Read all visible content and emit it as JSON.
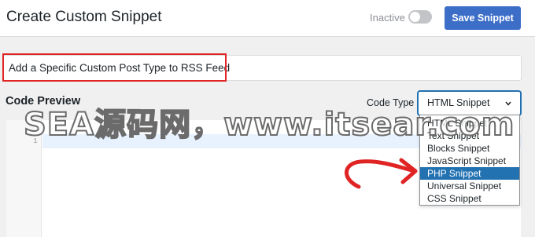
{
  "header": {
    "title": "Create Custom Snippet",
    "status_label": "Inactive",
    "toggle_state": "off",
    "save_label": "Save Snippet"
  },
  "snippet": {
    "title_value": "Add a Specific Custom Post Type to RSS Feed"
  },
  "code_section": {
    "preview_label": "Code Preview",
    "code_type_label": "Code Type",
    "selected_type": "HTML Snippet",
    "line_numbers": [
      "1"
    ]
  },
  "dropdown": {
    "options": [
      "HTML Snippet",
      "Text Snippet",
      "Blocks Snippet",
      "JavaScript Snippet",
      "PHP Snippet",
      "Universal Snippet",
      "CSS Snippet"
    ],
    "highlighted_option": "PHP Snippet"
  },
  "watermark": {
    "text": "SEA源码网，www.itsear.com"
  },
  "colors": {
    "accent": "#2271b1",
    "save_button": "#3c6ec8",
    "highlight_border": "#e02424",
    "arrow": "#e02424"
  },
  "icons": {
    "chevron": "chevron-down-icon",
    "arrow": "curved-arrow-icon"
  }
}
